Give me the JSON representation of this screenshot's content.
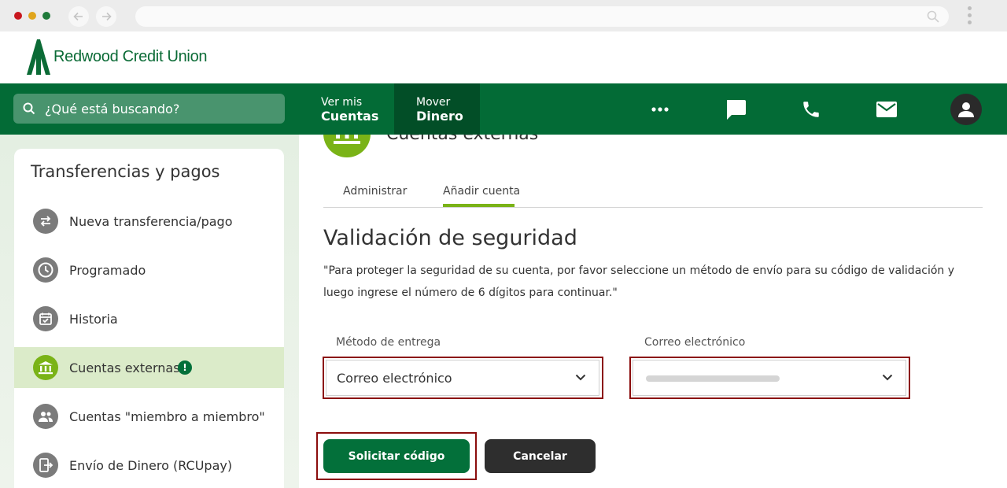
{
  "brand": {
    "name": "Redwood Credit Union",
    "color_primary": "#036b36",
    "color_accent": "#7ab317",
    "color_highlight": "#8b0d0d"
  },
  "header": {
    "search_placeholder": "¿Qué está buscando?",
    "nav": [
      {
        "small": "Ver mis",
        "big": "Cuentas"
      },
      {
        "small": "Mover",
        "big": "Dinero"
      }
    ],
    "icons": [
      "more-icon",
      "chat-icon",
      "phone-icon",
      "mail-icon",
      "user-icon"
    ]
  },
  "sidebar": {
    "title": "Transferencias y pagos",
    "items": [
      {
        "label": "Nueva transferencia/pago",
        "icon": "transfer-icon"
      },
      {
        "label": "Programado",
        "icon": "clock-icon"
      },
      {
        "label": "Historia",
        "icon": "calendar-check-icon"
      },
      {
        "label": "Cuentas externas",
        "icon": "bank-icon",
        "badge": "!"
      },
      {
        "label": "Cuentas \"miembro a miembro\"",
        "icon": "people-icon"
      },
      {
        "label": "Envío de Dinero (RCUpay)",
        "icon": "send-money-icon"
      }
    ]
  },
  "main": {
    "section_title": "Cuentas externas",
    "tabs": [
      {
        "label": "Administrar",
        "active": false
      },
      {
        "label": "Añadir cuenta",
        "active": true
      }
    ],
    "heading": "Validación de seguridad",
    "description": "\"Para proteger la seguridad de su cuenta, por favor seleccione un método de envío para su código de validación y luego ingrese el número de 6 dígitos para continuar.\"",
    "fields": {
      "method_label": "Método de entrega",
      "method_value": "Correo electrónico",
      "email_label": "Correo electrónico"
    },
    "buttons": {
      "request": "Solicitar código",
      "cancel": "Cancelar"
    }
  }
}
